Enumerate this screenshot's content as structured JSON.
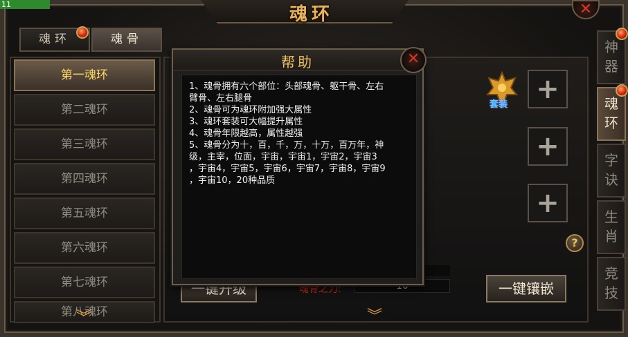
{
  "fps_counter": "11",
  "window": {
    "title": "魂环"
  },
  "top_tabs": [
    {
      "label": "魂环",
      "badge": true
    },
    {
      "label": "魂骨",
      "active": true
    }
  ],
  "ring_list": [
    {
      "label": "第一魂环",
      "active": true
    },
    {
      "label": "第二魂环"
    },
    {
      "label": "第三魂环"
    },
    {
      "label": "第四魂环"
    },
    {
      "label": "第五魂环"
    },
    {
      "label": "第六魂环"
    },
    {
      "label": "第七魂环"
    },
    {
      "label": "第八魂环"
    }
  ],
  "right_nav": [
    {
      "label": "神器",
      "badge": true
    },
    {
      "label": "魂环",
      "badge": true,
      "active": true
    },
    {
      "label": "字诀"
    },
    {
      "label": "生肖"
    },
    {
      "label": "竞技"
    }
  ],
  "main": {
    "suit_label": "套装",
    "slot_symbol": "+",
    "help_symbol": "?",
    "upgrade_button": "一键升级",
    "inlay_button": "一键镶嵌",
    "power_label": "魂骨之力:",
    "power_value": "10"
  },
  "help_dialog": {
    "title": "帮助",
    "close_symbol": "✕",
    "lines": [
      "1、魂骨拥有六个部位：头部魂骨、躯干骨、左右",
      "臂骨、左右腿骨",
      "2、魂骨可为魂环附加强大属性",
      "3、魂环套装可大幅提升属性",
      "4、魂骨年限越高，属性越强",
      "5、魂骨分为十，百，千，万，十万，百万年，神",
      "级，主宰，位面，宇宙，宇宙1，宇宙2，宇宙3",
      "，宇宙4，宇宙5，宇宙6，宇宙7，宇宙8，宇宙9",
      "，宇宙10，20种品质"
    ]
  },
  "colors": {
    "gold_title": "#e8b45a",
    "active_text": "#ffd868",
    "power_red": "#c8281a"
  }
}
